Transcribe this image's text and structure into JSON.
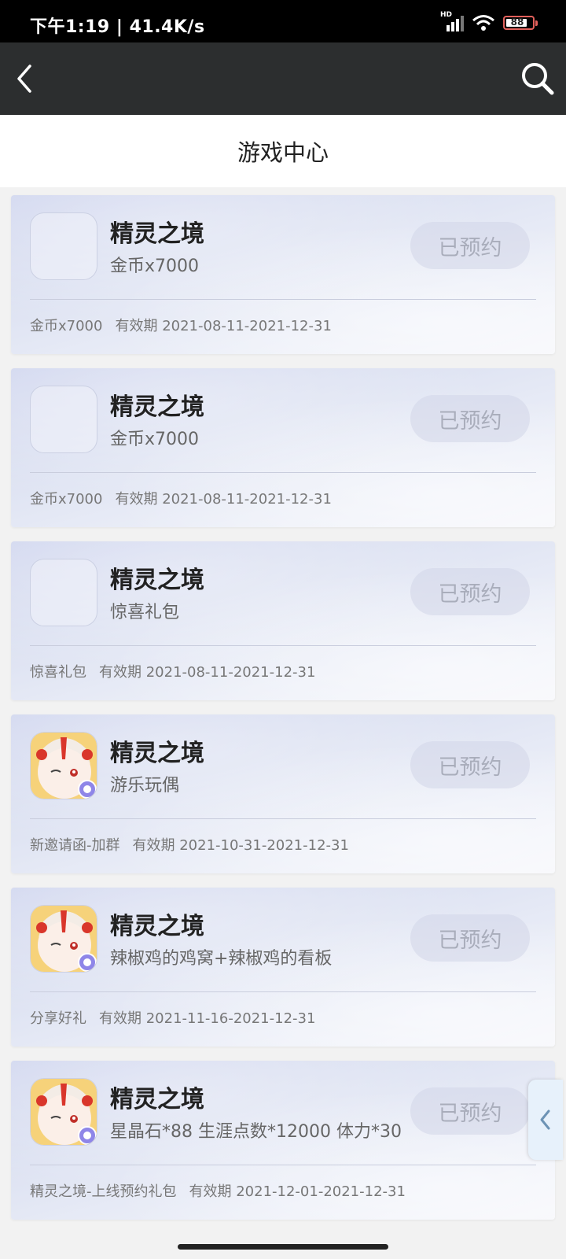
{
  "status_bar": {
    "time": "下午1:19 | 41.4K/s",
    "battery": "88"
  },
  "header": {
    "title": "游戏中心"
  },
  "cards": [
    {
      "game": "精灵之境",
      "reward": "金币x7000",
      "footer_label": "金币x7000",
      "validity": "有效期 2021-08-11-2021-12-31",
      "button": "已预约",
      "icon": "placeholder"
    },
    {
      "game": "精灵之境",
      "reward": "金币x7000",
      "footer_label": "金币x7000",
      "validity": "有效期 2021-08-11-2021-12-31",
      "button": "已预约",
      "icon": "placeholder"
    },
    {
      "game": "精灵之境",
      "reward": "惊喜礼包",
      "footer_label": "惊喜礼包",
      "validity": "有效期 2021-08-11-2021-12-31",
      "button": "已预约",
      "icon": "placeholder"
    },
    {
      "game": "精灵之境",
      "reward": "游乐玩偶",
      "footer_label": "新邀请函-加群",
      "validity": "有效期 2021-10-31-2021-12-31",
      "button": "已预约",
      "icon": "game-avatar"
    },
    {
      "game": "精灵之境",
      "reward": "辣椒鸡的鸡窝+辣椒鸡的看板",
      "footer_label": "分享好礼",
      "validity": "有效期 2021-11-16-2021-12-31",
      "button": "已预约",
      "icon": "game-avatar"
    },
    {
      "game": "精灵之境",
      "reward": "星晶石*88 生涯点数*12000 体力*30 ",
      "footer_label": "精灵之境-上线预约礼包",
      "validity": "有效期 2021-12-01-2021-12-31",
      "button": "已预约",
      "icon": "game-avatar"
    }
  ]
}
